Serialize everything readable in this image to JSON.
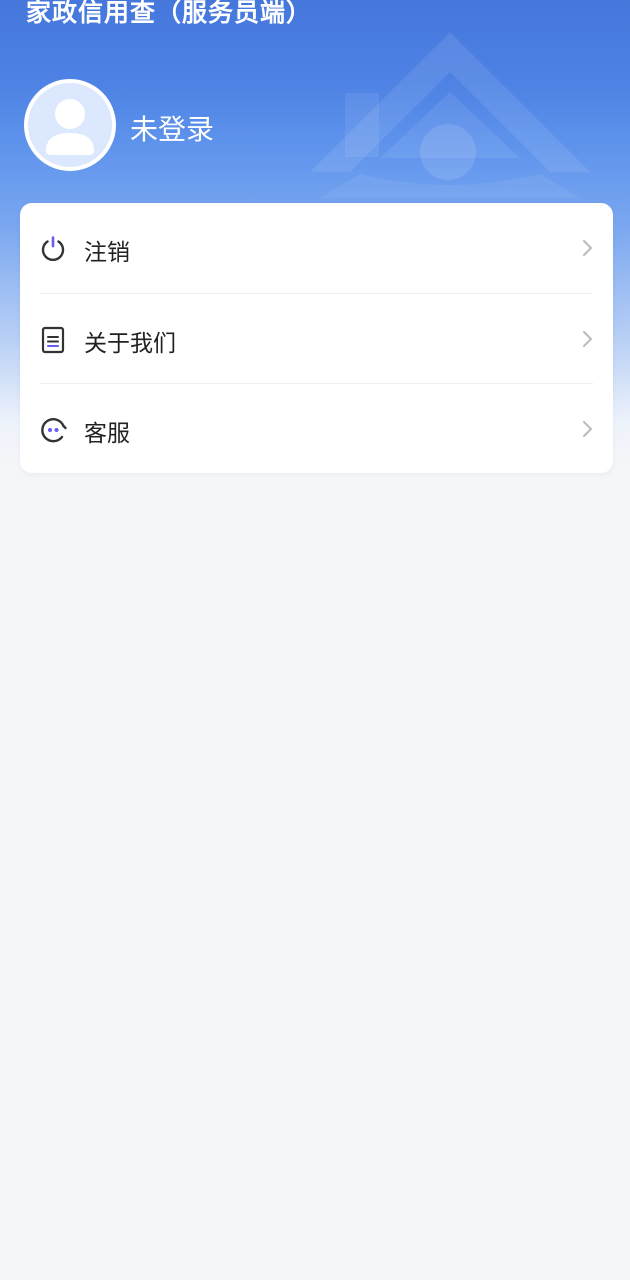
{
  "header": {
    "app_title": "家政信用查（服务员端）",
    "login_status": "未登录"
  },
  "menu": {
    "items": [
      {
        "label": "注销",
        "icon": "power-icon"
      },
      {
        "label": "关于我们",
        "icon": "document-icon"
      },
      {
        "label": "客服",
        "icon": "customer-service-icon"
      }
    ]
  },
  "colors": {
    "header_blue": "#4577dc",
    "page_background": "#f5f6f8",
    "icon_accent": "#6a5cf0",
    "icon_dark": "#333333",
    "chevron": "#bbbbbb"
  }
}
